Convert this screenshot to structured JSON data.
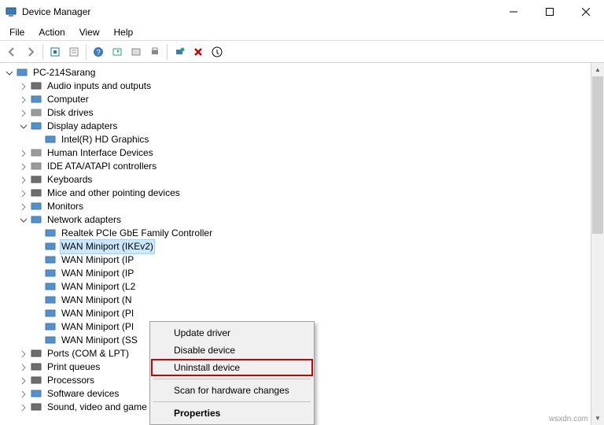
{
  "window": {
    "title": "Device Manager"
  },
  "menu": [
    "File",
    "Action",
    "View",
    "Help"
  ],
  "toolbar_icons": [
    "back",
    "forward",
    "|",
    "show-hidden",
    "properties",
    "|",
    "help",
    "update",
    "legacy",
    "print",
    "|",
    "scan",
    "delete",
    "action"
  ],
  "tree": {
    "root": {
      "label": "PC-214Sarang"
    },
    "categories": [
      {
        "label": "Audio inputs and outputs",
        "expand": "closed",
        "icon": "audio"
      },
      {
        "label": "Computer",
        "expand": "closed",
        "icon": "computer"
      },
      {
        "label": "Disk drives",
        "expand": "closed",
        "icon": "disk"
      },
      {
        "label": "Display adapters",
        "expand": "open",
        "icon": "display",
        "children": [
          {
            "label": "Intel(R) HD Graphics",
            "icon": "display"
          }
        ]
      },
      {
        "label": "Human Interface Devices",
        "expand": "closed",
        "icon": "hid"
      },
      {
        "label": "IDE ATA/ATAPI controllers",
        "expand": "closed",
        "icon": "ide"
      },
      {
        "label": "Keyboards",
        "expand": "closed",
        "icon": "keyboard"
      },
      {
        "label": "Mice and other pointing devices",
        "expand": "closed",
        "icon": "mouse"
      },
      {
        "label": "Monitors",
        "expand": "closed",
        "icon": "monitor"
      },
      {
        "label": "Network adapters",
        "expand": "open",
        "icon": "network",
        "children": [
          {
            "label": "Realtek PCIe GbE Family Controller",
            "icon": "network"
          },
          {
            "label": "WAN Miniport (IKEv2)",
            "icon": "network",
            "selected": true
          },
          {
            "label": "WAN Miniport (IP",
            "icon": "network"
          },
          {
            "label": "WAN Miniport (IP",
            "icon": "network"
          },
          {
            "label": "WAN Miniport (L2",
            "icon": "network"
          },
          {
            "label": "WAN Miniport (N",
            "icon": "network"
          },
          {
            "label": "WAN Miniport (PI",
            "icon": "network"
          },
          {
            "label": "WAN Miniport (PI",
            "icon": "network"
          },
          {
            "label": "WAN Miniport (SS",
            "icon": "network"
          }
        ]
      },
      {
        "label": "Ports (COM & LPT)",
        "expand": "closed",
        "icon": "port"
      },
      {
        "label": "Print queues",
        "expand": "closed",
        "icon": "printer"
      },
      {
        "label": "Processors",
        "expand": "closed",
        "icon": "cpu"
      },
      {
        "label": "Software devices",
        "expand": "closed",
        "icon": "software"
      },
      {
        "label": "Sound, video and game controllers",
        "expand": "closed",
        "icon": "sound"
      }
    ]
  },
  "context_menu": {
    "items": [
      {
        "label": "Update driver"
      },
      {
        "label": "Disable device"
      },
      {
        "label": "Uninstall device",
        "highlight": true
      },
      {
        "sep": true
      },
      {
        "label": "Scan for hardware changes"
      },
      {
        "sep": true
      },
      {
        "label": "Properties",
        "bold": true
      }
    ]
  },
  "watermark": "wsxdn.com"
}
